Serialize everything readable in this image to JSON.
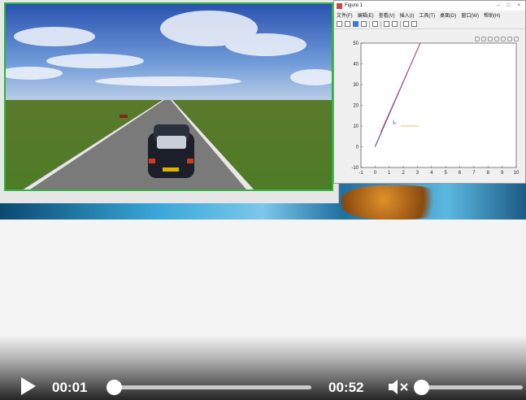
{
  "figure_window": {
    "title": "Figure 1",
    "controls": [
      "–",
      "□",
      "×"
    ],
    "menu": [
      "文件(F)",
      "编辑(E)",
      "查看(V)",
      "插入(I)",
      "工具(T)",
      "桌面(D)",
      "窗口(W)",
      "帮助(H)"
    ]
  },
  "chart_data": {
    "type": "line",
    "xlim": [
      -1,
      10
    ],
    "ylim": [
      -10,
      50
    ],
    "xticks": [
      -1,
      0,
      1,
      2,
      3,
      4,
      5,
      6,
      7,
      8,
      9,
      10
    ],
    "yticks": [
      -10,
      0,
      10,
      20,
      30,
      40,
      50
    ],
    "series": [
      {
        "color": "#3d3d9e",
        "x": [
          0,
          3.2
        ],
        "y": [
          0,
          50
        ]
      },
      {
        "color": "#b25b8a",
        "x": [
          0.4,
          3.2
        ],
        "y": [
          7,
          50
        ]
      },
      {
        "color": "#e3c84a",
        "x": [
          1.8,
          3.1
        ],
        "y": [
          10,
          10
        ]
      }
    ],
    "colors": {
      "line1": "#3d3d9e",
      "line2": "#b25b8a",
      "line3": "#e3c84a"
    }
  },
  "player": {
    "current_time": "00:01",
    "duration": "00:52",
    "progress": 0.0,
    "volume": 0.0,
    "muted": true,
    "icons": {
      "play": "play-icon",
      "mute": "speaker-muted-icon"
    }
  }
}
